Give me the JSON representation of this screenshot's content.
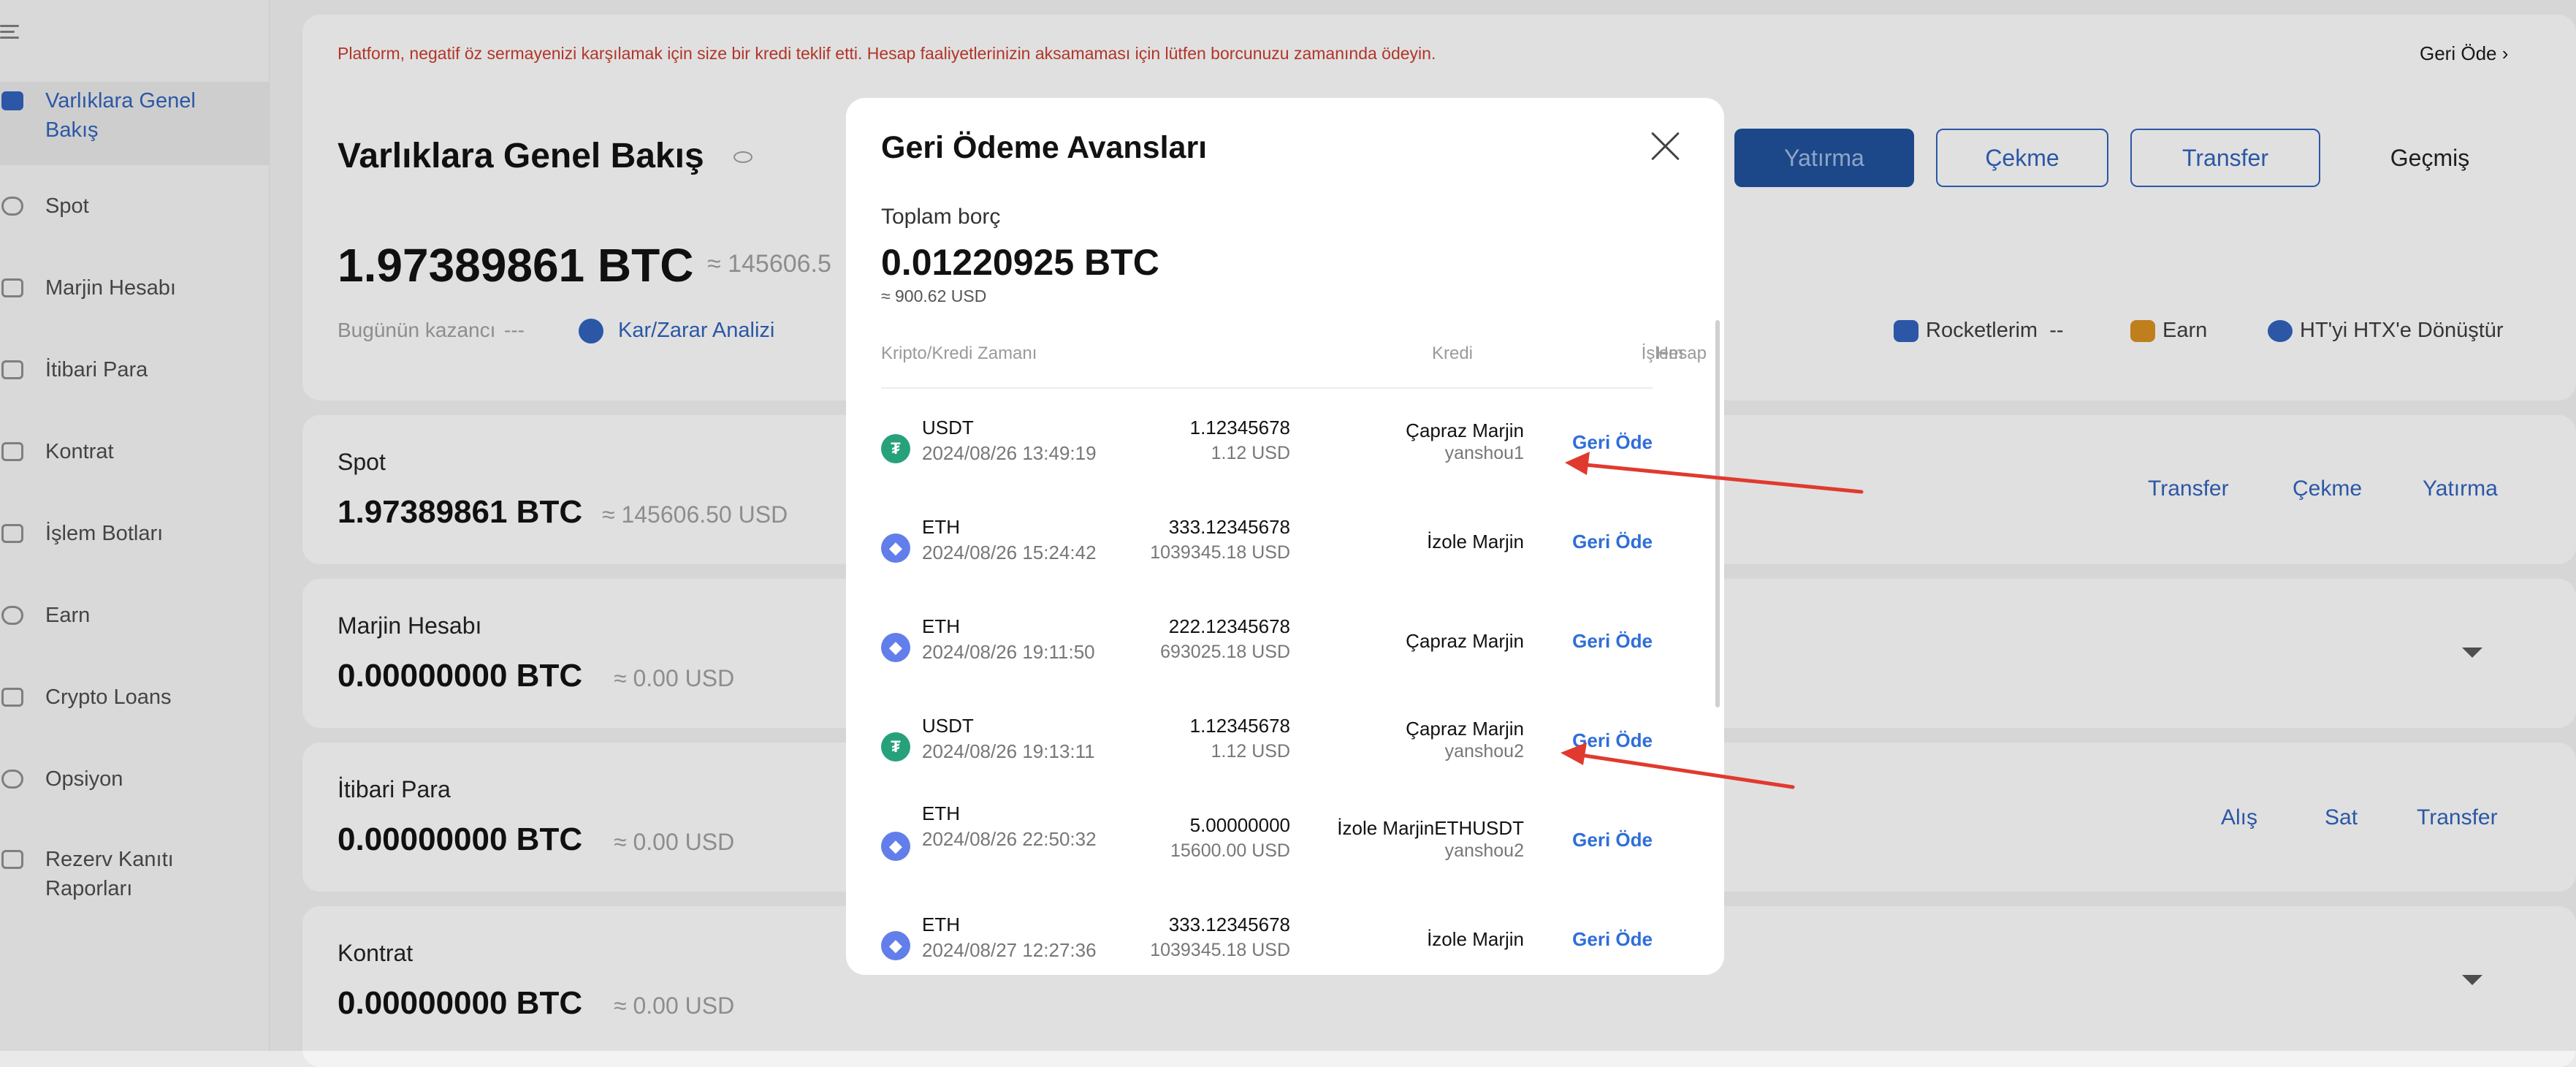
{
  "sidebar": {
    "items": [
      {
        "label": "Varlıklara Genel Bakış",
        "active": true
      },
      {
        "label": "Spot"
      },
      {
        "label": "Marjin Hesabı"
      },
      {
        "label": "İtibari Para"
      },
      {
        "label": "Kontrat"
      },
      {
        "label": "İşlem Botları"
      },
      {
        "label": "Earn"
      },
      {
        "label": "Crypto Loans"
      },
      {
        "label": "Opsiyon"
      },
      {
        "label": "Rezerv Kanıtı Raporları"
      }
    ]
  },
  "notice": {
    "text": "Platform, negatif öz sermayenizi karşılamak için size bir kredi teklif etti. Hesap faaliyetlerinizin aksamaması için lütfen borcunuzu zamanında ödeyin.",
    "link": "Geri Öde"
  },
  "overview": {
    "title": "Varlıklara Genel Bakış",
    "total": "1.97389861 BTC",
    "total_usd": "≈ 145606.5",
    "today_label": "Bugünün kazancı",
    "today_value": "---",
    "pnl_link": "Kar/Zarar Analizi",
    "buttons": {
      "deposit": "Yatırma",
      "withdraw": "Çekme",
      "transfer": "Transfer",
      "history": "Geçmiş"
    },
    "links": {
      "rockets": "Rocketlerim",
      "rockets_value": "--",
      "earn": "Earn",
      "convert": "HT'yi HTX'e Dönüştür"
    }
  },
  "sections": [
    {
      "title": "Spot",
      "value": "1.97389861 BTC",
      "usd": "≈ 145606.50 USD",
      "links": [
        "Transfer",
        "Çekme",
        "Yatırma"
      ]
    },
    {
      "title": "Marjin Hesabı",
      "value": "0.00000000 BTC",
      "usd": "≈ 0.00 USD"
    },
    {
      "title": "İtibari Para",
      "value": "0.00000000 BTC",
      "usd": "≈ 0.00 USD",
      "links": [
        "Alış",
        "Sat",
        "Transfer"
      ]
    },
    {
      "title": "Kontrat",
      "value": "0.00000000 BTC",
      "usd": "≈ 0.00 USD"
    }
  ],
  "modal": {
    "title": "Geri Ödeme Avansları",
    "debt_label": "Toplam borç",
    "debt": "0.01220925 BTC",
    "debt_usd": "≈ 900.62 USD",
    "columns": {
      "crypto": "Kripto/Kredi Zamanı",
      "credit": "Kredi",
      "account": "Hesap",
      "action": "İşlem"
    },
    "rows": [
      {
        "coin": "USDT",
        "time": "2024/08/26 13:49:19",
        "amount": "1.12345678",
        "usd": "1.12 USD",
        "account": "Çapraz Marjin",
        "sub": "yanshou1",
        "action": "Geri Öde"
      },
      {
        "coin": "ETH",
        "time": "2024/08/26 15:24:42",
        "amount": "333.12345678",
        "usd": "1039345.18 USD",
        "account": "İzole Marjin",
        "sub": "",
        "action": "Geri Öde"
      },
      {
        "coin": "ETH",
        "time": "2024/08/26 19:11:50",
        "amount": "222.12345678",
        "usd": "693025.18 USD",
        "account": "Çapraz Marjin",
        "sub": "",
        "action": "Geri Öde"
      },
      {
        "coin": "USDT",
        "time": "2024/08/26 19:13:11",
        "amount": "1.12345678",
        "usd": "1.12 USD",
        "account": "Çapraz Marjin",
        "sub": "yanshou2",
        "action": "Geri Öde"
      },
      {
        "coin": "ETH",
        "time": "2024/08/26 22:50:32",
        "amount": "5.00000000",
        "usd": "15600.00 USD",
        "account": "İzole MarjinETHUSDT",
        "sub": "yanshou2",
        "action": "Geri Öde"
      },
      {
        "coin": "ETH",
        "time": "2024/08/27 12:27:36",
        "amount": "333.12345678",
        "usd": "1039345.18 USD",
        "account": "İzole Marjin",
        "sub": "",
        "action": "Geri Öde"
      }
    ]
  },
  "colors": {
    "accent": "#2f5fb5",
    "annotation_arrow": "#e03a2f",
    "notice": "#c23a2c"
  },
  "icons": {
    "usdt": "tether-icon",
    "eth": "ethereum-icon",
    "close": "close-icon"
  }
}
